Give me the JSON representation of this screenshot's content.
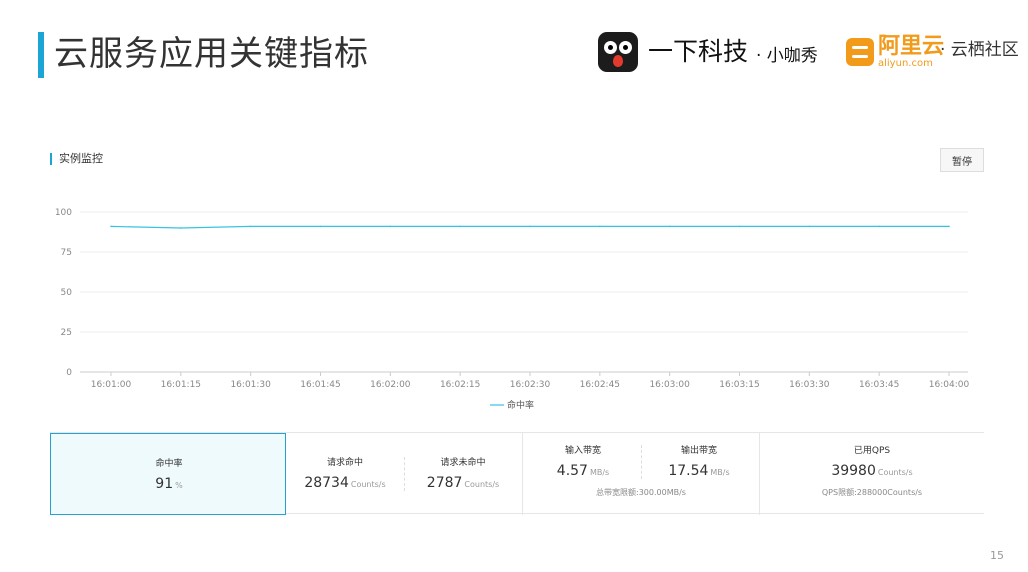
{
  "header": {
    "title": "云服务应用关键指标",
    "brand1_name": "一下科技",
    "brand1_sub": "· 小咖秀",
    "brand2_name": "阿里云",
    "brand2_en": "aliyun.com",
    "brand2_community": "· 云栖社区"
  },
  "monitor": {
    "section_label": "实例监控",
    "pause_label": "暂停"
  },
  "chart_data": {
    "type": "line",
    "x": [
      "16:01:00",
      "16:01:15",
      "16:01:30",
      "16:01:45",
      "16:02:00",
      "16:02:15",
      "16:02:30",
      "16:02:45",
      "16:03:00",
      "16:03:15",
      "16:03:30",
      "16:03:45",
      "16:04:00"
    ],
    "series": [
      {
        "name": "命中率",
        "values": [
          91,
          90,
          91,
          91,
          91,
          91,
          91,
          91,
          91,
          91,
          91,
          91,
          91
        ]
      }
    ],
    "y_ticks": [
      "100",
      "75",
      "50",
      "25",
      "0"
    ],
    "ylim": [
      0,
      100
    ],
    "grid": true,
    "legend": "bottom-center",
    "color": "#36c4e4"
  },
  "stats": {
    "hit_rate": {
      "label": "命中率",
      "value": "91",
      "unit": "%"
    },
    "req_hit": {
      "label": "请求命中",
      "value": "28734",
      "unit": "Counts/s"
    },
    "req_miss": {
      "label": "请求未命中",
      "value": "2787",
      "unit": "Counts/s"
    },
    "bw_in": {
      "label": "输入带宽",
      "value": "4.57",
      "unit": "MB/s"
    },
    "bw_out": {
      "label": "输出带宽",
      "value": "17.54",
      "unit": "MB/s"
    },
    "bw_limit": "总带宽限额:300.00MB/s",
    "qps": {
      "label": "已用QPS",
      "value": "39980",
      "unit": "Counts/s"
    },
    "qps_limit": "QPS限额:288000Counts/s"
  },
  "page_number": "15"
}
